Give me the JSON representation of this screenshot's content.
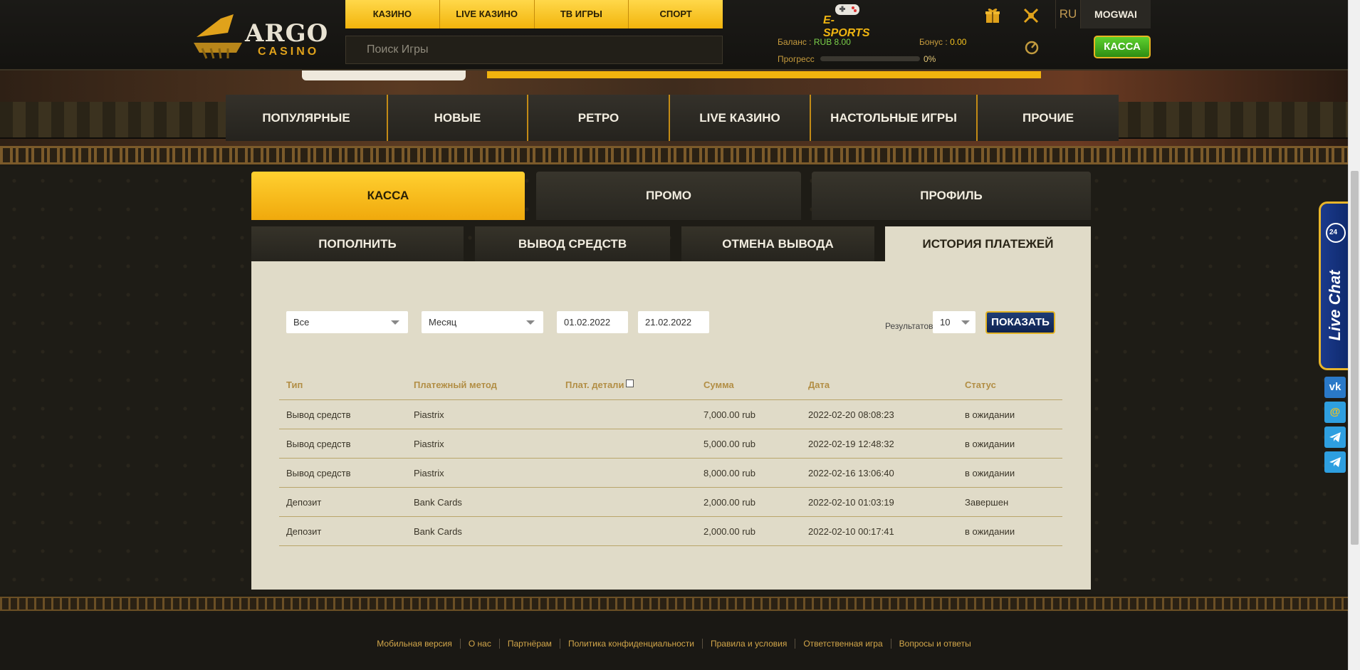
{
  "header": {
    "logo_top": "ARGO",
    "logo_bottom": "CASINO",
    "nav": [
      "КАЗИНО",
      "LIVE КАЗИНО",
      "ТВ ИГРЫ",
      "СПОРТ"
    ],
    "search_placeholder": "Поиск Игры",
    "esports_label": "E-SPORTS",
    "language": "RU",
    "username": "MOGWAI",
    "balance_label": "Баланс :",
    "balance_value": "RUB 8.00",
    "bonus_label": "Бонус :",
    "bonus_value": "0.00",
    "progress_label": "Прогресс",
    "progress_value": "0%",
    "progress_fraction": 0,
    "kassa_button": "КАССА"
  },
  "categories": [
    "ПОПУЛЯРНЫЕ",
    "НОВЫЕ",
    "РЕТРО",
    "LIVE КАЗИНО",
    "НАСТОЛЬНЫЕ ИГРЫ",
    "ПРОЧИЕ"
  ],
  "main_tabs": [
    "КАССА",
    "ПРОМО",
    "ПРОФИЛЬ"
  ],
  "sub_tabs": [
    "ПОПОЛНИТЬ",
    "ВЫВОД СРЕДСТВ",
    "ОТМЕНА ВЫВОДА",
    "ИСТОРИЯ ПЛАТЕЖЕЙ"
  ],
  "filters": {
    "type": "Все",
    "period": "Месяц",
    "date_from": "01.02.2022",
    "date_to": "21.02.2022",
    "results_label": "Результатов:",
    "results_count": "10",
    "show_button": "ПОКАЗАТЬ"
  },
  "table": {
    "headers": [
      "Тип",
      "Платежный метод",
      "Плат. детали",
      "Сумма",
      "Дата",
      "Статус"
    ],
    "rows": [
      [
        "Вывод средств",
        "Piastrix",
        "",
        "7,000.00 rub",
        "2022-02-20 08:08:23",
        "в ожидании"
      ],
      [
        "Вывод средств",
        "Piastrix",
        "",
        "5,000.00 rub",
        "2022-02-19 12:48:32",
        "в ожидании"
      ],
      [
        "Вывод средств",
        "Piastrix",
        "",
        "8,000.00 rub",
        "2022-02-16 13:06:40",
        "в ожидании"
      ],
      [
        "Депозит",
        "Bank Cards",
        "",
        "2,000.00 rub",
        "2022-02-10 01:03:19",
        "Завершен"
      ],
      [
        "Депозит",
        "Bank Cards",
        "",
        "2,000.00 rub",
        "2022-02-10 00:17:41",
        "в ожидании"
      ]
    ]
  },
  "footer": {
    "links": [
      "Мобильная версия",
      "О нас",
      "Партнёрам",
      "Политика конфиденциальности",
      "Правила и условия",
      "Ответственная игра",
      "Вопросы и ответы"
    ]
  },
  "side": {
    "live_chat": "Live Chat",
    "badge_24": "24",
    "social": [
      "vk-icon",
      "mail-icon",
      "telegram-icon",
      "telegram-icon"
    ]
  }
}
